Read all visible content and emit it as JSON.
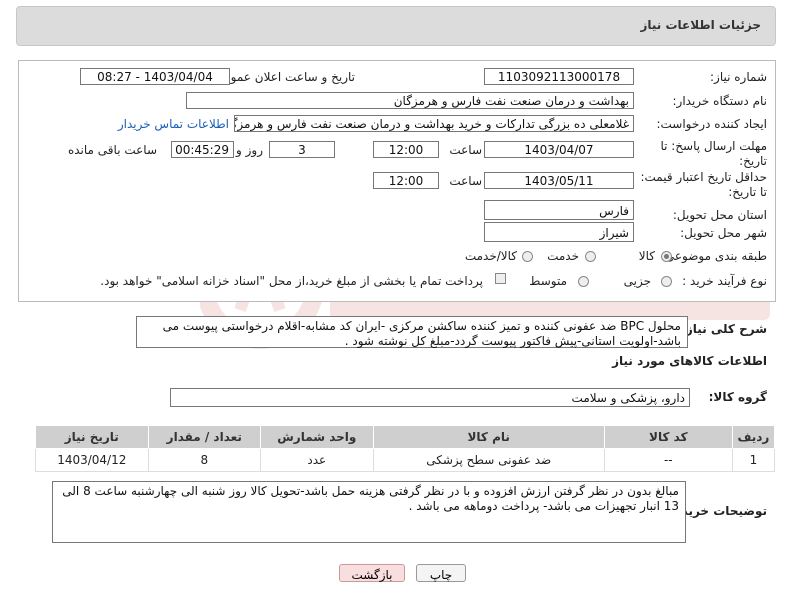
{
  "header": {
    "title": "جزئیات اطلاعات نیاز"
  },
  "form": {
    "need_number": {
      "label": "شماره نیاز:",
      "value": "1103092113000178"
    },
    "announce_datetime": {
      "label": "تاریخ و ساعت اعلان عمومی:",
      "value": "1403/04/04 - 08:27"
    },
    "buyer_org": {
      "label": "نام دستگاه خریدار:",
      "value": "بهداشت و درمان صنعت نفت فارس و هرمزگان"
    },
    "requester": {
      "label": "ایجاد کننده درخواست:",
      "value": "غلامعلی ده بزرگی تدارکات و خرید بهداشت و درمان صنعت نفت فارس و هرمزگان",
      "contact_link": "اطلاعات تماس خریدار"
    },
    "deadline": {
      "label": "مهلت ارسال پاسخ: تا تاریخ:",
      "date": "1403/04/07",
      "time_label": "ساعت",
      "time": "12:00",
      "days": "3",
      "days_label": "روز و",
      "remaining": "00:45:29",
      "remaining_label": "ساعت باقی مانده"
    },
    "validity": {
      "label": "حداقل تاریخ اعتبار قیمت: تا تاریخ:",
      "date": "1403/05/11",
      "time_label": "ساعت",
      "time": "12:00"
    },
    "province": {
      "label": "استان محل تحویل:",
      "value": "فارس"
    },
    "city": {
      "label": "شهر محل تحویل:",
      "value": "شیراز"
    },
    "category": {
      "label": "طبقه بندی موضوعی:",
      "options": [
        "کالا",
        "خدمت",
        "کالا/خدمت"
      ]
    },
    "process": {
      "label": "نوع فرآیند خرید :",
      "options": [
        "جزیی",
        "متوسط"
      ],
      "note": "پرداخت تمام یا بخشی از مبلغ خرید،از محل \"اسناد خزانه اسلامی\" خواهد بود."
    }
  },
  "description": {
    "label": "شرح کلی نیاز:",
    "text": "محلول BPC ضد عفونی کننده و تمیز کننده ساکشن مرکزی -ایران کد مشابه-اقلام درخواستی پیوست می باشد-اولویت استانی-پیش فاکتور پیوست گردد-مبلغ کل نوشته شود ."
  },
  "goods": {
    "section_title": "اطلاعات کالاهای مورد نیاز",
    "group_label": "گروه کالا:",
    "group_value": "دارو، پزشکی و سلامت",
    "columns": [
      "ردیف",
      "کد کالا",
      "نام کالا",
      "واحد شمارش",
      "تعداد / مقدار",
      "تاریخ نیاز"
    ],
    "rows": [
      [
        "1",
        "--",
        "ضد عفونی سطح پزشکی",
        "عدد",
        "8",
        "1403/04/12"
      ]
    ]
  },
  "buyer_notes": {
    "label": "توضیحات خریدار:",
    "text": "مبالغ بدون در نظر گرفتن ارزش افزوده و با در نظر گرفتی هزینه حمل باشد-تحویل کالا روز شنبه الی چهارشنبه ساعت 8 الی 13 انبار تجهیزات می باشد- پرداخت دوماهه می باشد ."
  },
  "buttons": {
    "print": "چاپ",
    "back": "بازگشت"
  },
  "colors": {
    "link": "#1a5fb4",
    "header_bg": "#dcdcdc",
    "table_header": "#cfcfcf",
    "back_button_bg": "#f8dede"
  }
}
